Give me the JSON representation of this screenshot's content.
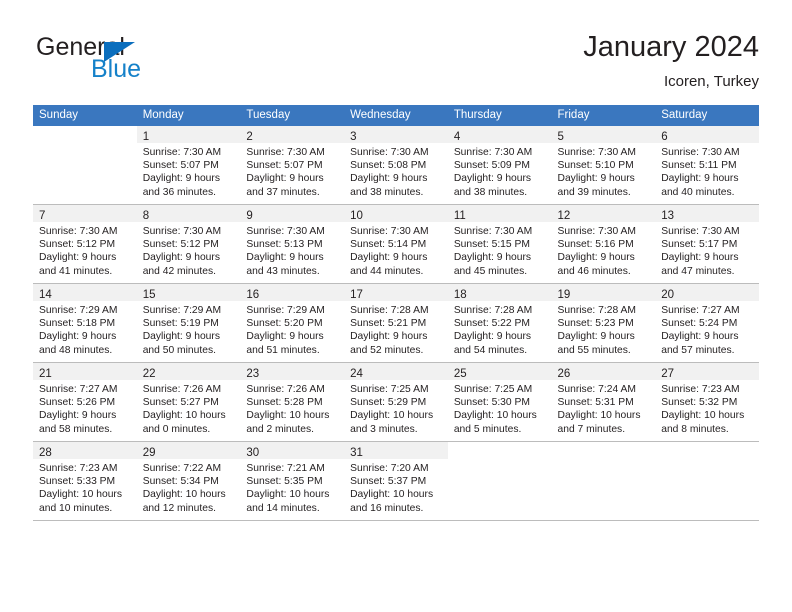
{
  "logo": {
    "word_one": "General",
    "word_two": "Blue",
    "triangle_color": "#0b6ebd",
    "blue_color": "#1581c9"
  },
  "header": {
    "title": "January 2024",
    "location": "Icoren, Turkey"
  },
  "theme": {
    "header_row_bg": "#3a77bf",
    "daynum_bg": "#f1f1f1",
    "grid_line": "#bcbcbc",
    "text": "#231f20"
  },
  "weekdays": [
    "Sunday",
    "Monday",
    "Tuesday",
    "Wednesday",
    "Thursday",
    "Friday",
    "Saturday"
  ],
  "weeks": [
    [
      {
        "day": "",
        "lines": []
      },
      {
        "day": "1",
        "lines": [
          "Sunrise: 7:30 AM",
          "Sunset: 5:07 PM",
          "Daylight: 9 hours",
          "and 36 minutes."
        ]
      },
      {
        "day": "2",
        "lines": [
          "Sunrise: 7:30 AM",
          "Sunset: 5:07 PM",
          "Daylight: 9 hours",
          "and 37 minutes."
        ]
      },
      {
        "day": "3",
        "lines": [
          "Sunrise: 7:30 AM",
          "Sunset: 5:08 PM",
          "Daylight: 9 hours",
          "and 38 minutes."
        ]
      },
      {
        "day": "4",
        "lines": [
          "Sunrise: 7:30 AM",
          "Sunset: 5:09 PM",
          "Daylight: 9 hours",
          "and 38 minutes."
        ]
      },
      {
        "day": "5",
        "lines": [
          "Sunrise: 7:30 AM",
          "Sunset: 5:10 PM",
          "Daylight: 9 hours",
          "and 39 minutes."
        ]
      },
      {
        "day": "6",
        "lines": [
          "Sunrise: 7:30 AM",
          "Sunset: 5:11 PM",
          "Daylight: 9 hours",
          "and 40 minutes."
        ]
      }
    ],
    [
      {
        "day": "7",
        "lines": [
          "Sunrise: 7:30 AM",
          "Sunset: 5:12 PM",
          "Daylight: 9 hours",
          "and 41 minutes."
        ]
      },
      {
        "day": "8",
        "lines": [
          "Sunrise: 7:30 AM",
          "Sunset: 5:12 PM",
          "Daylight: 9 hours",
          "and 42 minutes."
        ]
      },
      {
        "day": "9",
        "lines": [
          "Sunrise: 7:30 AM",
          "Sunset: 5:13 PM",
          "Daylight: 9 hours",
          "and 43 minutes."
        ]
      },
      {
        "day": "10",
        "lines": [
          "Sunrise: 7:30 AM",
          "Sunset: 5:14 PM",
          "Daylight: 9 hours",
          "and 44 minutes."
        ]
      },
      {
        "day": "11",
        "lines": [
          "Sunrise: 7:30 AM",
          "Sunset: 5:15 PM",
          "Daylight: 9 hours",
          "and 45 minutes."
        ]
      },
      {
        "day": "12",
        "lines": [
          "Sunrise: 7:30 AM",
          "Sunset: 5:16 PM",
          "Daylight: 9 hours",
          "and 46 minutes."
        ]
      },
      {
        "day": "13",
        "lines": [
          "Sunrise: 7:30 AM",
          "Sunset: 5:17 PM",
          "Daylight: 9 hours",
          "and 47 minutes."
        ]
      }
    ],
    [
      {
        "day": "14",
        "lines": [
          "Sunrise: 7:29 AM",
          "Sunset: 5:18 PM",
          "Daylight: 9 hours",
          "and 48 minutes."
        ]
      },
      {
        "day": "15",
        "lines": [
          "Sunrise: 7:29 AM",
          "Sunset: 5:19 PM",
          "Daylight: 9 hours",
          "and 50 minutes."
        ]
      },
      {
        "day": "16",
        "lines": [
          "Sunrise: 7:29 AM",
          "Sunset: 5:20 PM",
          "Daylight: 9 hours",
          "and 51 minutes."
        ]
      },
      {
        "day": "17",
        "lines": [
          "Sunrise: 7:28 AM",
          "Sunset: 5:21 PM",
          "Daylight: 9 hours",
          "and 52 minutes."
        ]
      },
      {
        "day": "18",
        "lines": [
          "Sunrise: 7:28 AM",
          "Sunset: 5:22 PM",
          "Daylight: 9 hours",
          "and 54 minutes."
        ]
      },
      {
        "day": "19",
        "lines": [
          "Sunrise: 7:28 AM",
          "Sunset: 5:23 PM",
          "Daylight: 9 hours",
          "and 55 minutes."
        ]
      },
      {
        "day": "20",
        "lines": [
          "Sunrise: 7:27 AM",
          "Sunset: 5:24 PM",
          "Daylight: 9 hours",
          "and 57 minutes."
        ]
      }
    ],
    [
      {
        "day": "21",
        "lines": [
          "Sunrise: 7:27 AM",
          "Sunset: 5:26 PM",
          "Daylight: 9 hours",
          "and 58 minutes."
        ]
      },
      {
        "day": "22",
        "lines": [
          "Sunrise: 7:26 AM",
          "Sunset: 5:27 PM",
          "Daylight: 10 hours",
          "and 0 minutes."
        ]
      },
      {
        "day": "23",
        "lines": [
          "Sunrise: 7:26 AM",
          "Sunset: 5:28 PM",
          "Daylight: 10 hours",
          "and 2 minutes."
        ]
      },
      {
        "day": "24",
        "lines": [
          "Sunrise: 7:25 AM",
          "Sunset: 5:29 PM",
          "Daylight: 10 hours",
          "and 3 minutes."
        ]
      },
      {
        "day": "25",
        "lines": [
          "Sunrise: 7:25 AM",
          "Sunset: 5:30 PM",
          "Daylight: 10 hours",
          "and 5 minutes."
        ]
      },
      {
        "day": "26",
        "lines": [
          "Sunrise: 7:24 AM",
          "Sunset: 5:31 PM",
          "Daylight: 10 hours",
          "and 7 minutes."
        ]
      },
      {
        "day": "27",
        "lines": [
          "Sunrise: 7:23 AM",
          "Sunset: 5:32 PM",
          "Daylight: 10 hours",
          "and 8 minutes."
        ]
      }
    ],
    [
      {
        "day": "28",
        "lines": [
          "Sunrise: 7:23 AM",
          "Sunset: 5:33 PM",
          "Daylight: 10 hours",
          "and 10 minutes."
        ]
      },
      {
        "day": "29",
        "lines": [
          "Sunrise: 7:22 AM",
          "Sunset: 5:34 PM",
          "Daylight: 10 hours",
          "and 12 minutes."
        ]
      },
      {
        "day": "30",
        "lines": [
          "Sunrise: 7:21 AM",
          "Sunset: 5:35 PM",
          "Daylight: 10 hours",
          "and 14 minutes."
        ]
      },
      {
        "day": "31",
        "lines": [
          "Sunrise: 7:20 AM",
          "Sunset: 5:37 PM",
          "Daylight: 10 hours",
          "and 16 minutes."
        ]
      },
      {
        "day": "",
        "lines": []
      },
      {
        "day": "",
        "lines": []
      },
      {
        "day": "",
        "lines": []
      }
    ]
  ]
}
